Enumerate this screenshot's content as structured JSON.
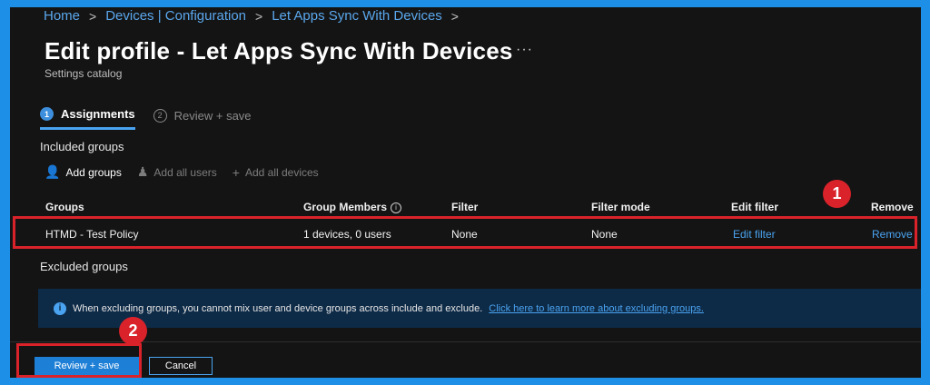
{
  "breadcrumb": [
    "Home",
    "Devices | Configuration",
    "Let Apps Sync With Devices"
  ],
  "page_title": "Edit profile - Let Apps Sync With Devices",
  "more_label": "···",
  "subtitle": "Settings catalog",
  "tabs": [
    {
      "step": "1",
      "label": "Assignments",
      "active": true
    },
    {
      "step": "2",
      "label": "Review + save",
      "active": false
    }
  ],
  "included_groups_label": "Included groups",
  "toolbar": {
    "add_groups": "Add groups",
    "add_all_users": "Add all users",
    "add_all_devices": "Add all devices"
  },
  "table": {
    "headers": [
      "Groups",
      "Group Members",
      "Filter",
      "Filter mode",
      "Edit filter",
      "Remove"
    ],
    "rows": [
      {
        "group": "HTMD - Test Policy",
        "members": "1 devices, 0 users",
        "filter": "None",
        "filter_mode": "None",
        "edit_filter": "Edit filter",
        "remove": "Remove"
      }
    ]
  },
  "excluded_groups_label": "Excluded groups",
  "banner": {
    "text": "When excluding groups, you cannot mix user and device groups across include and exclude.",
    "link": "Click here to learn more about excluding groups."
  },
  "buttons": {
    "review_save": "Review + save",
    "cancel": "Cancel"
  },
  "callouts": [
    "1",
    "2"
  ],
  "colors": {
    "accent": "#4aa3f0",
    "annotation_red": "#d9222a",
    "frame_blue": "#1e8fe6"
  }
}
